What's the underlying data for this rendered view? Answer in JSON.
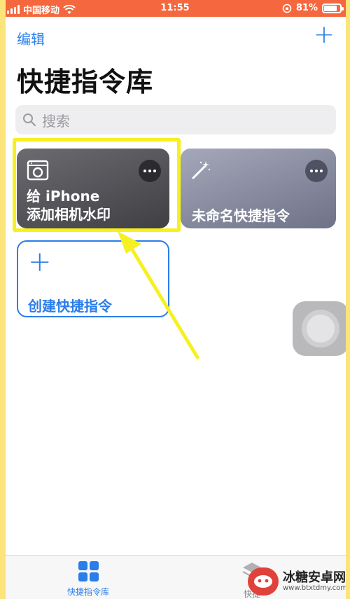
{
  "status_bar": {
    "carrier": "中国移动",
    "time": "11:55",
    "battery": "81%",
    "battery_level": 0.81
  },
  "nav": {
    "edit_label": "编辑",
    "add_label": "+"
  },
  "page_title": "快捷指令库",
  "search": {
    "placeholder": "搜索"
  },
  "shortcuts": [
    {
      "title_line1": "给 iPhone",
      "title_line2": "添加相机水印",
      "icon": "washing-machine-icon",
      "color": "#4f4f54"
    },
    {
      "title": "未命名快捷指令",
      "icon": "magic-wand-icon",
      "color": "#8b8ea3"
    }
  ],
  "create": {
    "plus": "+",
    "label": "创建快捷指令"
  },
  "tab_bar": {
    "tabs": [
      {
        "label": "快捷指令库",
        "icon": "grid-icon",
        "active": true
      },
      {
        "label": "快捷",
        "icon": "layers-icon",
        "active": false
      }
    ]
  },
  "watermark": {
    "brand": "冰糖安卓网",
    "url": "www.btxtdmy.com"
  },
  "colors": {
    "accent": "#2b7de9",
    "status_bar": "#f5683f",
    "highlight": "#f6f021"
  }
}
